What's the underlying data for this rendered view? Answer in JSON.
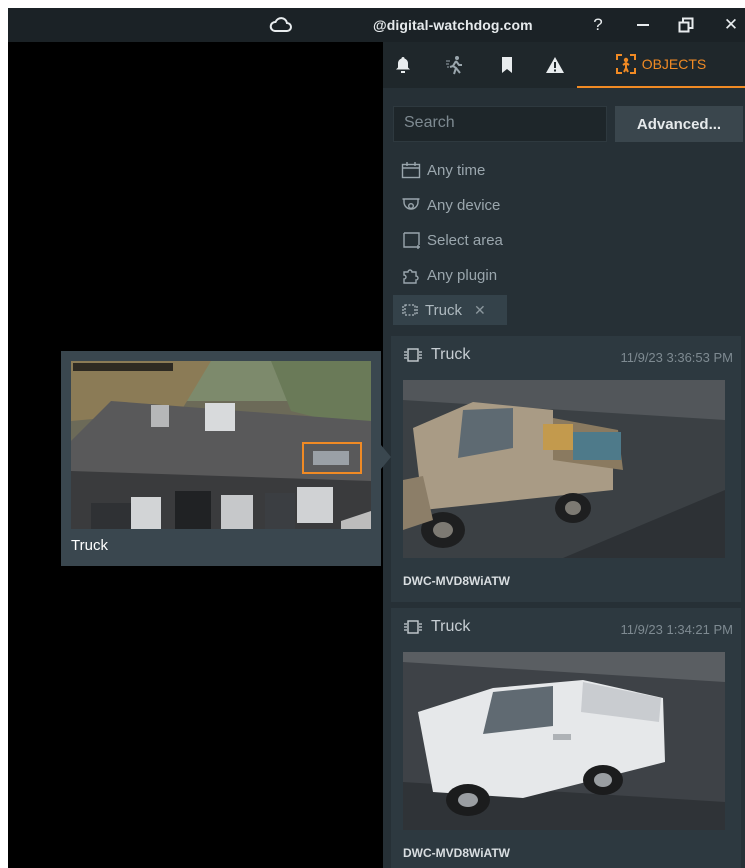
{
  "titlebar": {
    "cloud_icon": "cloud-icon",
    "user": "@digital-watchdog.com",
    "help_label": "?",
    "minimize_icon": "minimize-icon",
    "restore_icon": "restore-window-icon",
    "close_label": "✕"
  },
  "tabs": {
    "items": [
      {
        "icon": "bell-icon"
      },
      {
        "icon": "motion-icon"
      },
      {
        "icon": "bookmark-icon"
      },
      {
        "icon": "warning-icon"
      }
    ],
    "objects_label": "OBJECTS",
    "accent": "#f08a24"
  },
  "search": {
    "placeholder": "Search",
    "advanced_label": "Advanced..."
  },
  "filters": {
    "time": "Any time",
    "device": "Any device",
    "area": "Select area",
    "plugin": "Any plugin",
    "chip_label": "Truck",
    "chip_remove": "✕"
  },
  "results": [
    {
      "type": "Truck",
      "time": "11/9/23 3:36:53 PM",
      "camera": "DWC-MVD8WiATW"
    },
    {
      "type": "Truck",
      "time": "11/9/23 1:34:21 PM",
      "camera": "DWC-MVD8WiATW"
    }
  ],
  "preview": {
    "label": "Truck"
  }
}
